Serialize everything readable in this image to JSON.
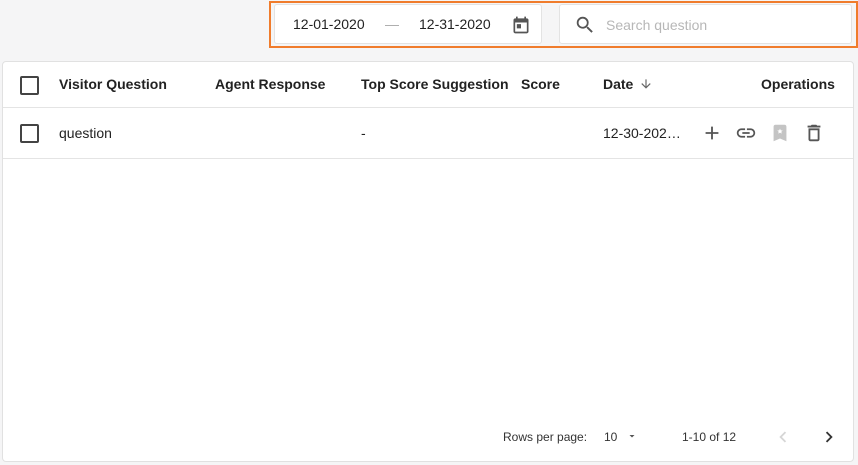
{
  "filters": {
    "date_start": "12-01-2020",
    "date_separator": "—",
    "date_end": "12-31-2020",
    "calendar_icon": "calendar-icon",
    "search_placeholder": "Search question",
    "search_value": "",
    "search_icon": "search-icon"
  },
  "table": {
    "columns": {
      "visitor_question": "Visitor Question",
      "agent_response": "Agent Response",
      "top_score_suggestion": "Top Score Suggestion",
      "score": "Score",
      "date": "Date",
      "operations": "Operations"
    },
    "date_sort": "descending",
    "rows": [
      {
        "visitor_question": "question",
        "agent_response": "",
        "top_score_suggestion": "-",
        "score": "",
        "date": "12-30-202…",
        "operations": [
          "add-icon",
          "link-icon",
          "bookmark-icon",
          "delete-icon"
        ]
      }
    ]
  },
  "pagination": {
    "rows_per_page_label": "Rows per page:",
    "rows_per_page_value": "10",
    "range_label": "1-10 of 12"
  },
  "colors": {
    "highlight": "#f07c2c",
    "icon": "#555555",
    "icon_disabled": "#c4c4c4"
  }
}
